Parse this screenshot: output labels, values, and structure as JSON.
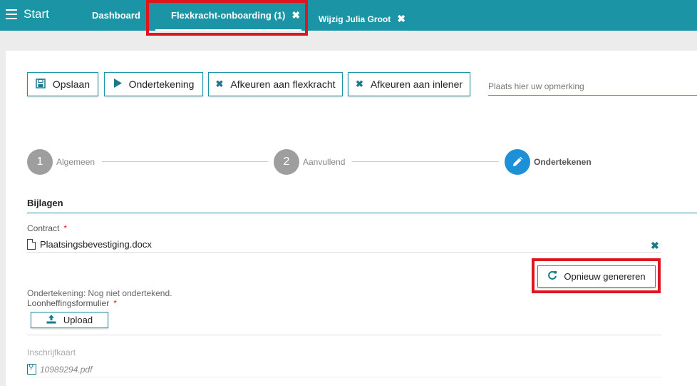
{
  "topbar": {
    "start_label": "Start",
    "tabs": [
      {
        "label": "Dashboard"
      },
      {
        "label": "Flexkracht-onboarding (1)",
        "close": "✖"
      },
      {
        "label": "Wijzig Julia Groot",
        "close": "✖"
      }
    ]
  },
  "toolbar": {
    "save_label": "Opslaan",
    "sign_label": "Ondertekening",
    "reject_flex_label": "Afkeuren aan flexkracht",
    "reject_inlener_label": "Afkeuren aan inlener",
    "remark_placeholder": "Plaats hier uw opmerking"
  },
  "stepper": {
    "steps": [
      {
        "number": "1",
        "label": "Algemeen"
      },
      {
        "number": "2",
        "label": "Aanvullend"
      },
      {
        "number": "",
        "label": "Ondertekenen",
        "active": true
      }
    ]
  },
  "attachments": {
    "title": "Bijlagen",
    "contract_label": "Contract",
    "required_mark": "*",
    "contract_file": "Plaatsingsbevestiging.docx",
    "regenerate_label": "Opnieuw genereren",
    "signature_status": "Ondertekening: Nog niet ondertekend.",
    "payroll_label": "Loonheffingsformulier",
    "upload_label": "Upload",
    "registration_label": "Inschrijfkaart",
    "registration_file": "10989294.pdf"
  },
  "colors": {
    "brand": "#1b95a6",
    "active_step": "#1e90d8",
    "highlight": "#e0161e"
  }
}
